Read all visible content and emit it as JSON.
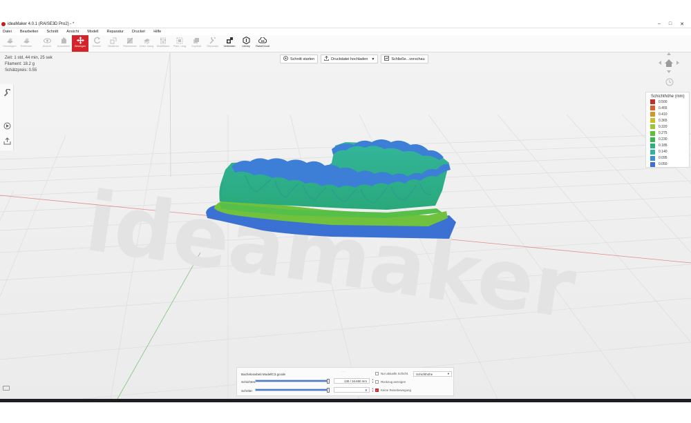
{
  "window": {
    "title": "ideaMaker 4.0.1 (RAISE3D Pro2) - *"
  },
  "menu": [
    "Datei",
    "Bearbeiten",
    "Schnitt",
    "Ansicht",
    "Modell",
    "Reparatur",
    "Drucker",
    "Hilfe"
  ],
  "toolbar": [
    {
      "label": "Hinzufügen",
      "icon": "add-model-icon"
    },
    {
      "label": "Entfernen",
      "icon": "remove-model-icon"
    },
    {
      "label": "Ansicht",
      "icon": "eye-icon"
    },
    {
      "label": "Auswählen",
      "icon": "hand-icon"
    },
    {
      "label": "Bewegen",
      "icon": "move-arrows-icon",
      "active": true
    },
    {
      "label": "Drehen",
      "icon": "rotate-icon"
    },
    {
      "label": "Skalieren",
      "icon": "scale-icon"
    },
    {
      "label": "Flächebnen",
      "icon": "flatten-icon"
    },
    {
      "label": "Unter..stung",
      "icon": "support-icon"
    },
    {
      "label": "Modifikator",
      "icon": "modifier-icon"
    },
    {
      "label": "Platz..rung",
      "icon": "arrange-icon"
    },
    {
      "label": "Duplikat",
      "icon": "duplicate-icon"
    },
    {
      "label": "Reparatur",
      "icon": "repair-icon"
    },
    {
      "label": "Verbinden",
      "icon": "connect-icon",
      "enabled": true
    },
    {
      "label": "Library",
      "icon": "library-icon",
      "enabled": true
    },
    {
      "label": "RaiseCloud",
      "icon": "cloud-icon",
      "enabled": true
    }
  ],
  "slice_info": {
    "time": "Zeit: 1 std, 44 min, 25 sek",
    "filament": "Filament: 18.2 g",
    "estimate": "Schätzpreis: 0.55"
  },
  "top_buttons": {
    "start_slice": "Schnitt starten",
    "upload": "Druckdatei hochladen",
    "close_preview": "Schließe...vorschau"
  },
  "legend": {
    "title": "Schichthöhe (mm)",
    "items": [
      {
        "value": "0.500",
        "color": "#c0302a"
      },
      {
        "value": "0.455",
        "color": "#d55f2c"
      },
      {
        "value": "0.410",
        "color": "#d4952c"
      },
      {
        "value": "0.365",
        "color": "#c5bf2e"
      },
      {
        "value": "0.320",
        "color": "#9cc436"
      },
      {
        "value": "0.275",
        "color": "#5fbe3c"
      },
      {
        "value": "0.230",
        "color": "#38b555"
      },
      {
        "value": "0.185",
        "color": "#2fb07b"
      },
      {
        "value": "0.140",
        "color": "#34b3a3"
      },
      {
        "value": "0.095",
        "color": "#3d8fcf"
      },
      {
        "value": "0.050",
        "color": "#3f6fd6"
      }
    ]
  },
  "layer_panel": {
    "file_name": "Bachelorarbeit ModellC3.gcode",
    "layers_label": "Schichten:",
    "layers_value": "130 / 16.650 mm",
    "layers_fraction": 0.98,
    "steps_label": "Schritte:",
    "steps_value": "9",
    "steps_fraction": 0.98,
    "only_current_layer": "Nur aktuelle Schicht",
    "show_retraction": "Rückzug anzeigen",
    "no_travel": "Keine Reisebewegung",
    "mode_select": "Schichthöhe",
    "grip": "...."
  },
  "colors": {
    "accent": "#d3232b",
    "model_green": "#2fae86",
    "model_blue": "#3d74d6"
  }
}
